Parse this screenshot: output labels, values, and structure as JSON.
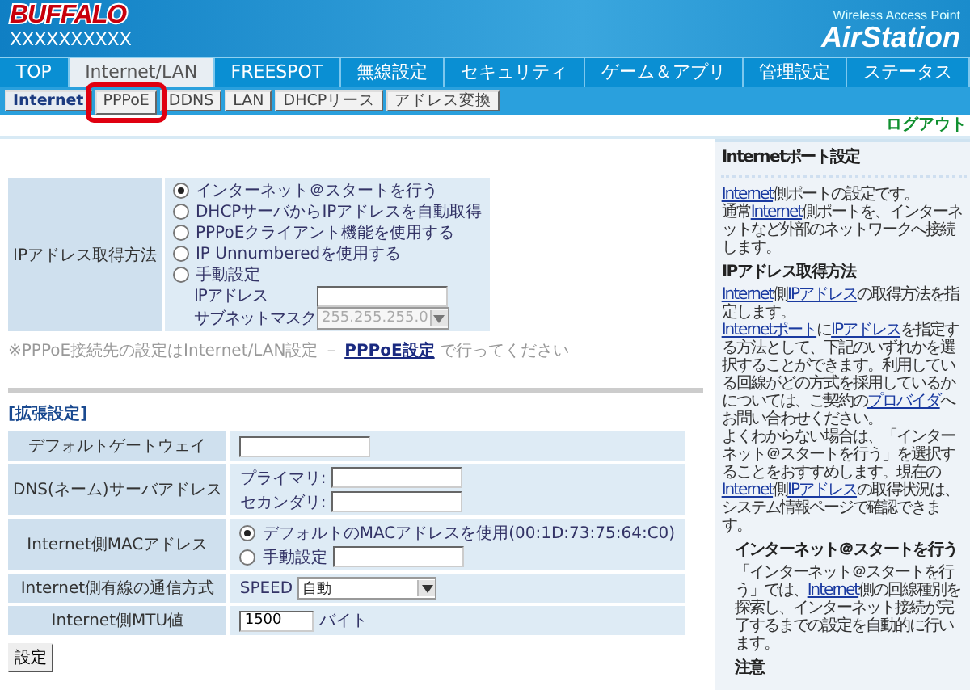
{
  "header": {
    "logo": "BUFFALO",
    "device_name": "XXXXXXXXXX",
    "product_line": "Wireless Access Point",
    "product": "AirStation"
  },
  "tabs": [
    {
      "label": "TOP",
      "selected": false
    },
    {
      "label": "Internet/LAN",
      "selected": true
    },
    {
      "label": "FREESPOT",
      "selected": false
    },
    {
      "label": "無線設定",
      "selected": false
    },
    {
      "label": "セキュリティ",
      "selected": false
    },
    {
      "label": "ゲーム＆アプリ",
      "selected": false
    },
    {
      "label": "管理設定",
      "selected": false
    },
    {
      "label": "ステータス",
      "selected": false
    }
  ],
  "subtabs": [
    {
      "label": "Internet",
      "selected": true,
      "highlighted": false
    },
    {
      "label": "PPPoE",
      "selected": false,
      "highlighted": true
    },
    {
      "label": "DDNS",
      "selected": false,
      "highlighted": false
    },
    {
      "label": "LAN",
      "selected": false,
      "highlighted": false
    },
    {
      "label": "DHCPリース",
      "selected": false,
      "highlighted": false
    },
    {
      "label": "アドレス変換",
      "selected": false,
      "highlighted": false
    }
  ],
  "logout": "ログアウト",
  "ip_method": {
    "label": "IPアドレス取得方法",
    "options": [
      {
        "label": "インターネット＠スタートを行う",
        "selected": true
      },
      {
        "label": "DHCPサーバからIPアドレスを自動取得",
        "selected": false
      },
      {
        "label": "PPPoEクライアント機能を使用する",
        "selected": false
      },
      {
        "label": "IP Unnumberedを使用する",
        "selected": false
      },
      {
        "label": "手動設定",
        "selected": false
      }
    ],
    "ip_address_label": "IPアドレス",
    "subnet_label": "サブネットマスク",
    "subnet_value": "255.255.255.0"
  },
  "note": [
    {
      "t": "※PPPoE接続先の設定はInternet/LAN設定 － "
    },
    {
      "t": "PPPoE設定",
      "link": true
    },
    {
      "t": " で行ってください"
    }
  ],
  "advanced": {
    "title": "[拡張設定]",
    "gateway_label": "デフォルトゲートウェイ",
    "dns_label": "DNS(ネーム)サーバアドレス",
    "dns_primary": "プライマリ:",
    "dns_secondary": "セカンダリ:",
    "mac_label": "Internet側MACアドレス",
    "mac_options": [
      {
        "label": "デフォルトのMACアドレスを使用(00:1D:73:75:64:C0)",
        "selected": true,
        "kind": "plain"
      },
      {
        "label": "手動設定",
        "selected": false,
        "kind": "field"
      }
    ],
    "speed_label": "Internet側有線の通信方式",
    "speed_prefix": "SPEED",
    "speed_value": "自動",
    "mtu_label": "Internet側MTU値",
    "mtu_value": "1500",
    "mtu_unit": "バイト"
  },
  "submit": "設定",
  "help": [
    {
      "kind": "main",
      "heading": "Internetポート設定",
      "divider": true,
      "paragraphs": [
        [
          {
            "t": "Internet",
            "link": true
          },
          {
            "t": "側ポートの設定です。"
          }
        ],
        [
          {
            "t": "通常"
          },
          {
            "t": "Internet",
            "link": true
          },
          {
            "t": "側ポートを、インターネットなど外部のネットワークへ接続します。"
          }
        ]
      ]
    },
    {
      "kind": "main",
      "heading": "IPアドレス取得方法",
      "divider": false,
      "paragraphs": [
        [
          {
            "t": "Internet",
            "link": true
          },
          {
            "t": "側"
          },
          {
            "t": "IPアドレス",
            "link": true
          },
          {
            "t": "の取得方法を指定します。"
          }
        ],
        [
          {
            "t": "Internetポート",
            "link": true
          },
          {
            "t": "に"
          },
          {
            "t": "IPアドレス",
            "link": true
          },
          {
            "t": "を指定する方法として、下記のいずれかを選択することができます。利用している回線がどの方式を採用しているかについては、ご契約の"
          },
          {
            "t": "プロバイダ",
            "link": true
          },
          {
            "t": "へお問い合わせください。"
          }
        ],
        [
          {
            "t": "よくわからない場合は、「インターネット＠スタートを行う」を選択することをおすすめします。現在の"
          },
          {
            "t": "Internet",
            "link": true
          },
          {
            "t": "側"
          },
          {
            "t": "IPアドレス",
            "link": true
          },
          {
            "t": "の取得状況は、システム情報ページで確認できます。"
          }
        ]
      ]
    },
    {
      "kind": "sub",
      "heading": "インターネット＠スタートを行う",
      "divider": false,
      "paragraphs": [
        [
          {
            "t": "「インターネット＠スタートを行う」では、"
          },
          {
            "t": "Internet",
            "link": true
          },
          {
            "t": "側の回線種別を探索し、インターネット接続が完了するまでの設定を自動的に行います。"
          }
        ]
      ]
    },
    {
      "kind": "sub",
      "heading": "注意",
      "divider": false
    }
  ]
}
